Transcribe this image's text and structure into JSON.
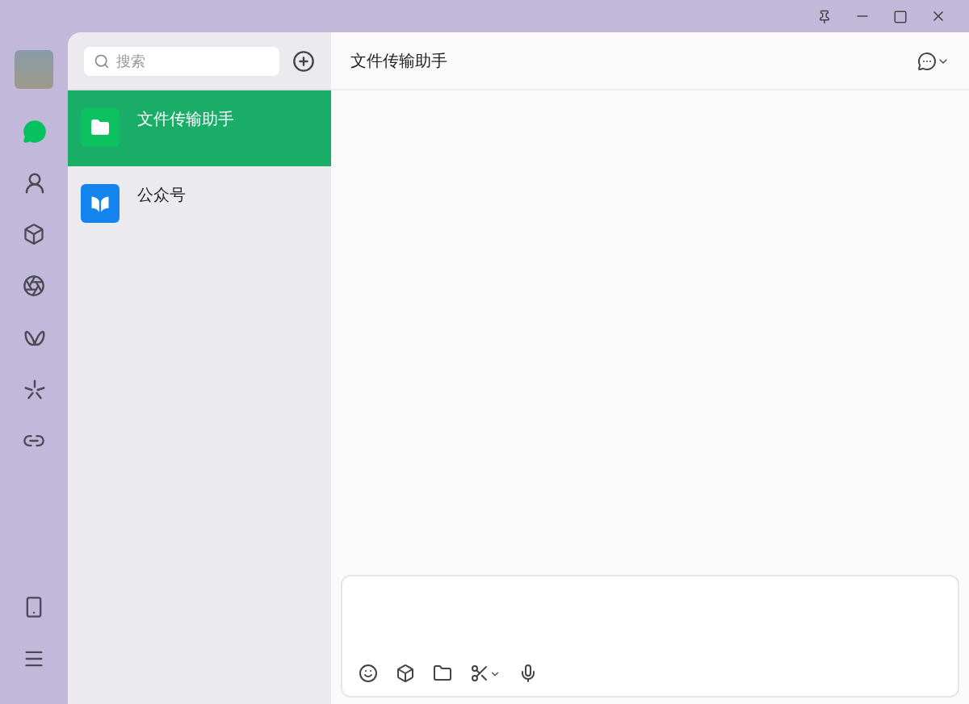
{
  "rail": {
    "items": [
      {
        "kind": "chats",
        "selected": true
      },
      {
        "kind": "contacts",
        "selected": false
      },
      {
        "kind": "favorites",
        "selected": false
      },
      {
        "kind": "moments",
        "selected": false
      },
      {
        "kind": "channels",
        "selected": false
      },
      {
        "kind": "discover",
        "selected": false
      },
      {
        "kind": "mini_programs",
        "selected": false
      }
    ],
    "bottom": [
      {
        "kind": "phone",
        "selected": false
      },
      {
        "kind": "menu",
        "selected": false
      }
    ]
  },
  "search": {
    "placeholder": "搜索"
  },
  "chats": [
    {
      "name": "文件传输助手",
      "kind": "file",
      "selected": true
    },
    {
      "name": "公众号",
      "kind": "official",
      "selected": false
    }
  ],
  "conversation": {
    "title": "文件传输助手"
  }
}
